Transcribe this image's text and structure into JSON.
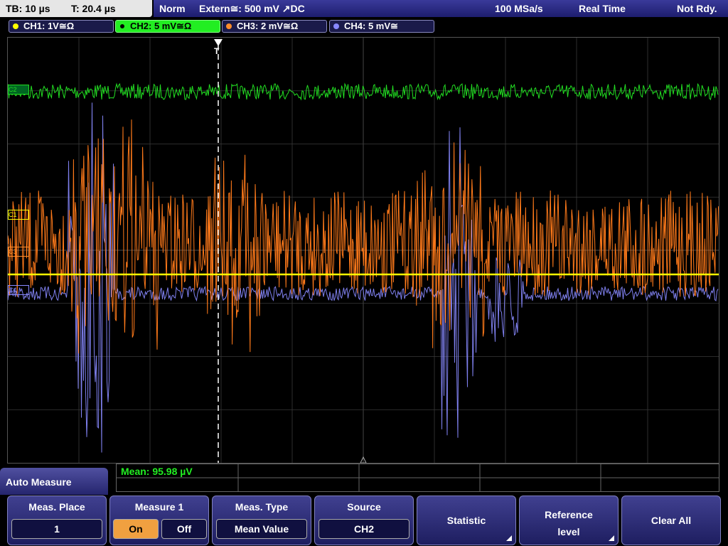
{
  "status_bar": {
    "timebase": "TB: 10 µs",
    "trigger_time": "T: 20.4 µs",
    "trigger_mode": "Norm",
    "trigger_source": "Extern≅: 500 mV ↗DC",
    "sample_rate": "100 MSa/s",
    "acq_mode": "Real Time",
    "state": "Not Rdy."
  },
  "channels": [
    {
      "label": "CH1: 1V≅Ω",
      "color": "#ffff00"
    },
    {
      "label": "CH2: 5 mV≅Ω",
      "color": "#22dd22",
      "active": true
    },
    {
      "label": "CH3: 2 mV≅Ω",
      "color": "#ff8c2a"
    },
    {
      "label": "CH4: 5 mV≅",
      "color": "#8888ff"
    }
  ],
  "markers": {
    "c2": "C2",
    "c1": "C1",
    "c3": "C3",
    "c4": "C4",
    "trigger": "T"
  },
  "measurement": {
    "text": "Mean: 95.98 µV"
  },
  "menu": {
    "title": "Auto Measure",
    "meas_place": {
      "label": "Meas. Place",
      "value": "1"
    },
    "measure1": {
      "label": "Measure 1",
      "on": "On",
      "off": "Off",
      "selected": "On"
    },
    "meas_type": {
      "label": "Meas. Type",
      "value": "Mean Value"
    },
    "source": {
      "label": "Source",
      "value": "CH2"
    },
    "statistic": {
      "label": "Statistic"
    },
    "reference": {
      "line1": "Reference",
      "line2": "level"
    },
    "clear_all": {
      "label": "Clear All"
    }
  },
  "colors": {
    "accent_on": "#f0a040",
    "active_channel": "#22ee22"
  }
}
